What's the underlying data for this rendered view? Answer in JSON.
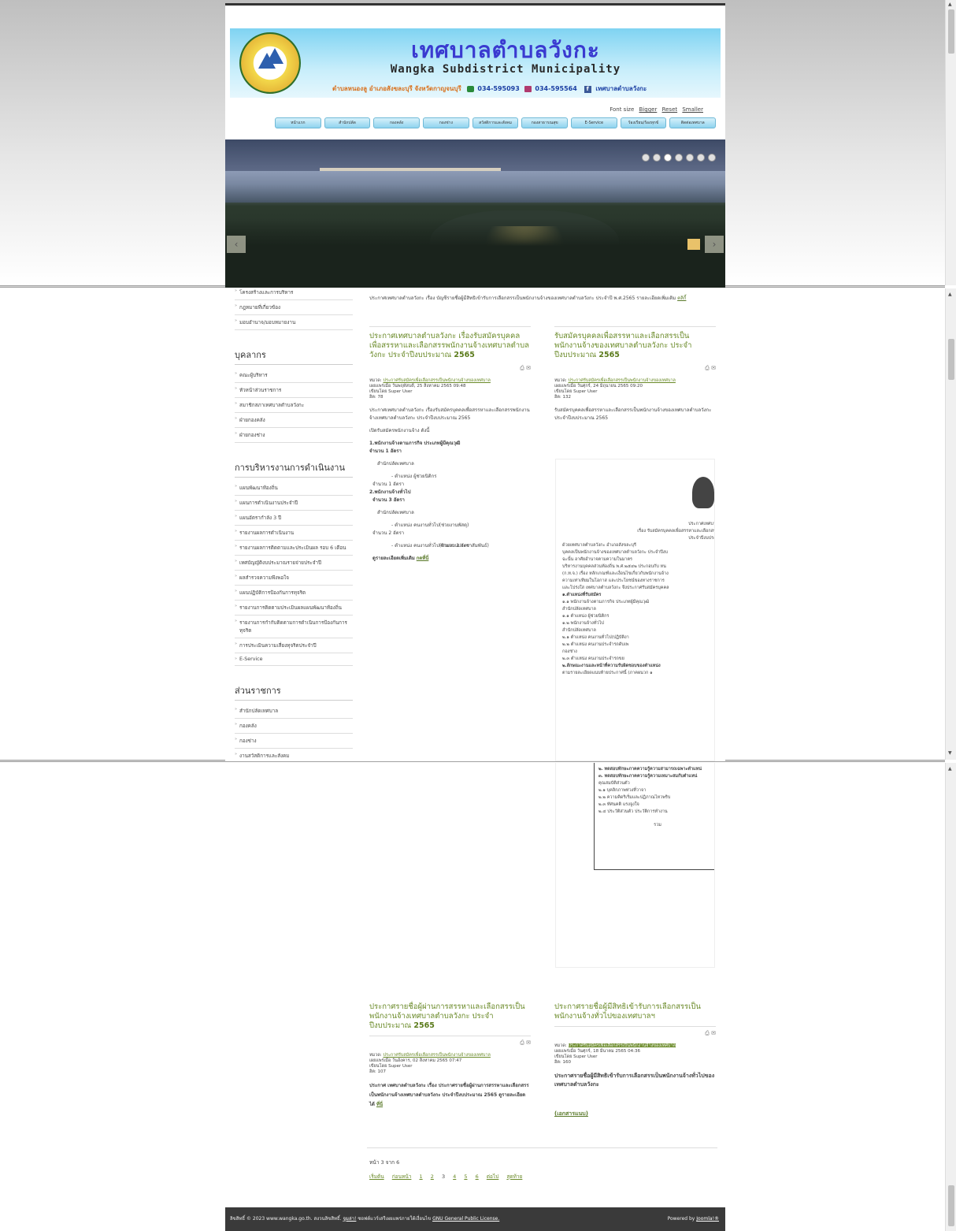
{
  "header": {
    "title_th": "เทศบาลตำบลวังกะ",
    "title_en": "Wangka Subdistrict Municipality",
    "address": "ตำบลหนองลู อำเภอสังขละบุรี จังหวัดกาญจนบุรี",
    "phone": "034-595093",
    "fax": "034-595564",
    "facebook": "เทศบาลตำบลวังกะ"
  },
  "fontsize": {
    "label": "Font size",
    "bigger": "Bigger",
    "reset": "Reset",
    "smaller": "Smaller"
  },
  "nav": [
    "หน้าแรก",
    "สำนักปลัด",
    "กองคลัง",
    "กองช่าง",
    "สวัสดิการและสังคม",
    "กองสาธารณสุข",
    "E-Service",
    "ร้องเรียน/ร้องทุกข์",
    "ติดต่อเทศบาล"
  ],
  "sidebar_top": [
    "โครงสร้างและการบริหาร",
    "กฎหมายที่เกี่ยวข้อง",
    "มอบอำนาจ/มอบหมายงาน"
  ],
  "sidebar_sections": [
    {
      "title": "บุคลากร",
      "items": [
        "คณะผู้บริหาร",
        "หัวหน้าส่วนราชการ",
        "สมาชิกสภาเทศบาลตำบลวังกะ",
        "ฝ่ายกองคลัง",
        "ฝ่ายกองช่าง"
      ]
    },
    {
      "title": "การบริหารงานการดำเนินงาน",
      "items": [
        "แผนพัฒนาท้องถิ่น",
        "แผนการดำเนินงานประจำปี",
        "แผนอัตรากำลัง 3 ปี",
        "รายงานผลการดำเนินงาน",
        "รายงานผลการติดตามและประเมินผล รอบ 6 เดือน",
        "เทศบัญญัติงบประมาณรายจ่ายประจำปี",
        "ผลสำรวจความพึงพอใจ",
        "แผนปฏิบัติการป้องกันการทุจริต",
        "รายงานการติดตามประเมินผลแผนพัฒนาท้องถิ่น",
        "รายงานการกำกับติดตามการดำเนินการป้องกันการทุจริต",
        "การประเมินความเสี่ยงทุจริตประจำปี",
        "E-Service"
      ]
    },
    {
      "title": "ส่วนราชการ",
      "items": [
        "สำนักปลัดเทศบาล",
        "กองคลัง",
        "กองช่าง",
        "งานสวัสดิการและสังคม"
      ]
    }
  ],
  "intro": {
    "text": "ประกาศเทศบาลตำบลวังกะ เรื่อง บัญชีรายชื่อผู้มีสิทธิเข้ารับการเลือกสรรเป็นพนักงานจ้างของเทศบาลตำบลวังกะ ประจำปี พ.ศ.2565 รายละเอียดเพิ่มเติม",
    "link": "คลิกี้"
  },
  "articles": [
    {
      "title": "ประกาศเทศบาลตำบลวังกะ เรื่องรับสมัครบุคคลเพื่อสรรหาและเลือกสรรพนักงานจ้างเทศบาลตำบลวังกะ ประจำปีงบประมาณ",
      "year": "2565",
      "category_label": "หมวด:",
      "category": "ประกาศรับสมัครเพื่อเลือกสรรเป็นพนักงานจ้างของเทศบาล",
      "published": "เผยแพร่เมื่อ วันพฤหัสบดี, 25 สิงหาคม 2565 09:48",
      "author": "เขียนโดย Super User",
      "hits": "ฮิต: 78",
      "body": [
        "ประกาศเทศบาลตำบลวังกะ เรื่องรับสมัครบุคคลเพื่อสรรหาและเลือกสรรพนักงานจ้างเทศบาลตำบลวังกะ ประจำปีงบประมาณ 2565",
        "เปิดรับสมัครพนักงานจ้าง ดังนี้"
      ],
      "sections": [
        {
          "head": "1.พนักงานจ้างตามภารกิจ ประเภทผู้มีคุณวุฒิ",
          "count": "จำนวน 1 อัตรา",
          "unit": "สำนักปลัดเทศบาล",
          "positions": [
            {
              "name": "- ตำแหน่ง ผู้ช่วยนิติกร",
              "count": "จำนวน 1 อัตรา"
            }
          ]
        },
        {
          "head": "2.พนักงานจ้างทั่วไป",
          "count": "จำนวน 3 อัตรา",
          "unit": "สำนักปลัดเทศบาล",
          "positions": [
            {
              "name": "- ตำแหน่ง คนงานทั่วไป(ช่วยงานพัสดุ)",
              "count": "จำนวน 2 อัตรา"
            },
            {
              "name": "- ตำแหน่ง คนงานทั่วไป(ช่วยงานประชาสัมพันธ์)",
              "count": "จำนวน 1 อัตรา"
            }
          ]
        }
      ],
      "more": "ดูรายละเอียดเพิ่มเติม",
      "more_link": "กดที่นี่"
    },
    {
      "title": "รับสมัครบุคคลเพื่อสรรหาและเลือกสรรเป็นพนักงานจ้างของเทศบาลตำบลวังกะ ประจำปีงบประมาณ",
      "year": "2565",
      "category_label": "หมวด:",
      "category": "ประกาศรับสมัครเพื่อเลือกสรรเป็นพนักงานจ้างของเทศบาล",
      "published": "เผยแพร่เมื่อ วันศุกร์, 24 มิถุนายน 2565 09:20",
      "author": "เขียนโดย Super User",
      "hits": "ฮิต: 132",
      "body": [
        "รับสมัครบุคคลเพื่อสรรหาและเลือกสรรเป็นพนักงานจ้างของเทศบาลตำบลวังกะ ประจำปีงบประมาณ 2565"
      ]
    },
    {
      "title": "ประกาศรายชื่อผู้ผ่านการสรรหาและเลือกสรรเป็นพนักงานจ้างเทศบาลตำบลวังกะ ประจำปีงบประมาณ",
      "year": "2565",
      "category_label": "หมวด:",
      "category": "ประกาศรับสมัครเพื่อเลือกสรรเป็นพนักงานจ้างของเทศบาล",
      "published": "เผยแพร่เมื่อ วันอังคาร, 02 สิงหาคม 2565 07:47",
      "author": "เขียนโดย Super User",
      "hits": "ฮิต: 107",
      "body": [
        "ประกาศ เทศบาลตำบลวังกะ เรื่อง ประกาศรายชื่อผู้ผ่านการสรรหาและเลือกสรรเป็นพนักงานจ้างเทศบาลตำบลวังกะ ประจำปีงบประมาณ 2565 ดูรายละเอียดได้"
      ],
      "link": "ที่นี่"
    },
    {
      "title": "ประกาศรายชื่อผู้มีสิทธิเข้ารับการเลือกสรรเป็นพนักงานจ้างทั่วไปของเทศบาลฯ",
      "category_label": "หมวด:",
      "category": "ประกาศรับสมัครเพื่อเลือกสรรเป็นพนักงานจ้างของเทศบาล",
      "published": "เผยแพร่เมื่อ วันศุกร์, 18 มีนาคม 2565 04:36",
      "author": "เขียนโดย Super User",
      "hits": "ฮิต: 160",
      "body": [
        "ประกาศรายชื่อผู้มีสิทธิเข้ารับการเลือกสรรเป็นพนักงานจ้างทั่วไปของเทศบาลตำบลวังกะ"
      ],
      "attachment": "(เอกสารแนบ)"
    }
  ],
  "document_lines": [
    "ประกาศเทศบา",
    "เรื่อง รับสมัครบุคคลเพื่อสรรหาและเลือกสร",
    "ประจำปีงบประ",
    "ด้วยเทศบาลตำบลวังกะ อำเภอสังขละบุรี",
    "บุคคลเป็นพนักงานจ้างของเทศบาลตำบลวังกะ ประจำปีงบ",
    "ฉะนั้น อาศัยอำนาจตามความในมาตร",
    "บริหารงานบุคคลส่วนท้องถิ่น พ.ศ.๒๕๔๒ ประกอบกับ หน",
    "(ก.ท.จ.) เรื่อง หลักเกณฑ์และเงื่อนไขเกี่ยวกับพนักงานจ้าง",
    "ความเท่าเทียมในโอกาส และประโยชน์ของทางราชการ",
    "และโปร่งใส เทศบาลตำบลวังกะ จึงประกาศรับสมัครบุคคล",
    "๑.ตำแหน่งที่รับสมัคร",
    "๑.๑ พนักงานจ้างตามภารกิจ ประเภทผู้มีคุณวุฒิ",
    "สำนักปลัดเทศบาล",
    "๑.๑ ตำแหน่ง ผู้ช่วยนิติกร",
    "๑.๒ พนักงานจ้างทั่วไป",
    "สำนักปลัดเทศบาล",
    "๒.๑ ตำแหน่ง คนงานทั่วไป(ปฏิบัติงา",
    "๒.๒ ตำแหน่ง คนงานประจำรถดับเพ",
    "กองช่าง",
    "๒.๓ ตำแหน่ง คนงานประจำรถขย",
    "๒.ลักษณะงานและหน้าที่ความรับผิดชอบของตำแหน่ง",
    "ตามรายละเอียดแนบท้ายประกาศนี้ (ภาคผนวก ๑",
    "๒. ทดสอบทักษะภาคความรู้ความสามารถเฉพาะตำแหน่",
    "๓. ทดสอบทักษะภาคความรู้ความเหมาะสมกับตำแหน่",
    "คุณสมบัติส่วนตัว",
    "๒.๑ บุคลิกภาพท่วงที่วาจา",
    "๒.๒ ความคิดริเริ่มและปฏิภาณไหวพริบ",
    "๒.๓ ทัศนคติ แรงจูงใจ",
    "๒.๔ ประวัติส่วนตัว ประวัติการทำงาน",
    "รวม"
  ],
  "pagination": {
    "summary": "หน้า 3 จาก 6",
    "start": "เริ่มต้น",
    "prev": "ก่อนหน้า",
    "pages": [
      "1",
      "2",
      "3",
      "4",
      "5",
      "6"
    ],
    "next": "ต่อไป",
    "end": "สุดท้าย"
  },
  "footer": {
    "copyright": "ลิขสิทธิ์ © 2023 www.wangka.go.th. สงวนลิขสิทธิ์.",
    "joomla_free": "จูมล่า!",
    "license_text": "ซอฟต์แวร์เสรีเผยแพร่ภายใต้เงื่อนไข",
    "license_link": "GNU General Public License.",
    "powered": "Powered by",
    "joomla": "Joomla!®"
  },
  "colors": {
    "title_green": "#6a8a28",
    "header_blue": "#7fd3f2",
    "footer_bg": "#3a3a3a"
  }
}
